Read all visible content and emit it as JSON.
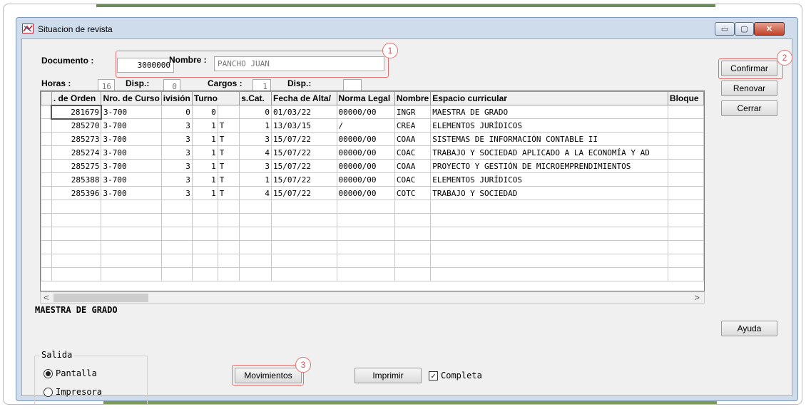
{
  "window": {
    "title": "Situacion de revista",
    "min_glyph": "▭",
    "max_glyph": "▢",
    "close_glyph": "✕"
  },
  "form": {
    "documento_label": "Documento :",
    "documento_value": "3000000",
    "nombre_label": "Nombre :",
    "nombre_value": "PANCHO JUAN",
    "horas_label": "Horas :",
    "horas_value": "16",
    "disp1_label": "Disp.:",
    "disp1_value": "0",
    "cargos_label": "Cargos :",
    "cargos_value": "1",
    "disp2_label": "Disp.:",
    "disp2_value": ""
  },
  "buttons": {
    "confirmar": "Confirmar",
    "renovar": "Renovar",
    "cerrar": "Cerrar",
    "ayuda": "Ayuda",
    "movimientos": "Movimientos",
    "imprimir": "Imprimir"
  },
  "callouts": {
    "one": "1",
    "two": "2",
    "three": "3"
  },
  "grid": {
    "columns": [
      ". de Orden",
      "Nro. de Curso",
      "ivisión",
      "Turno",
      "s.Cat.",
      "Fecha de Alta/",
      "Norma Legal",
      "Nombre",
      "Espacio curricular",
      "Bloque"
    ],
    "rows": [
      [
        "281679",
        "3-700",
        "0",
        "0",
        "",
        "0",
        "01/03/22",
        "00000/00",
        "INGR",
        "MAESTRA DE GRADO",
        ""
      ],
      [
        "285270",
        "3-700",
        "3",
        "1",
        "T",
        "1",
        "13/03/15",
        "/",
        "CREA",
        "ELEMENTOS JURÍDICOS",
        ""
      ],
      [
        "285273",
        "3-700",
        "3",
        "1",
        "T",
        "3",
        "15/07/22",
        "00000/00",
        "COAA",
        "SISTEMAS DE INFORMACIÓN CONTABLE II",
        ""
      ],
      [
        "285274",
        "3-700",
        "3",
        "1",
        "T",
        "4",
        "15/07/22",
        "00000/00",
        "COAC",
        "TRABAJO Y SOCIEDAD APLICADO A LA ECONOMÍA Y AD",
        ""
      ],
      [
        "285275",
        "3-700",
        "3",
        "1",
        "T",
        "3",
        "15/07/22",
        "00000/00",
        "COAA",
        "PROYECTO Y GESTIÓN DE MICROEMPRENDIMIENTOS",
        ""
      ],
      [
        "285388",
        "3-700",
        "3",
        "1",
        "T",
        "1",
        "15/07/22",
        "00000/00",
        "COAC",
        "ELEMENTOS JURÍDICOS",
        ""
      ],
      [
        "285396",
        "3-700",
        "3",
        "1",
        "T",
        "4",
        "15/07/22",
        "00000/00",
        "COTC",
        "TRABAJO Y SOCIEDAD",
        ""
      ]
    ],
    "empty_rows": 6,
    "scroll_left": "<",
    "scroll_right": ">"
  },
  "status": {
    "selected_description": "MAESTRA DE GRADO"
  },
  "salida": {
    "title": "Salida",
    "options": [
      "Pantalla",
      "Impresora"
    ],
    "selected": "Pantalla"
  },
  "completa": {
    "label": "Completa",
    "checked": true,
    "glyph": "✓"
  }
}
